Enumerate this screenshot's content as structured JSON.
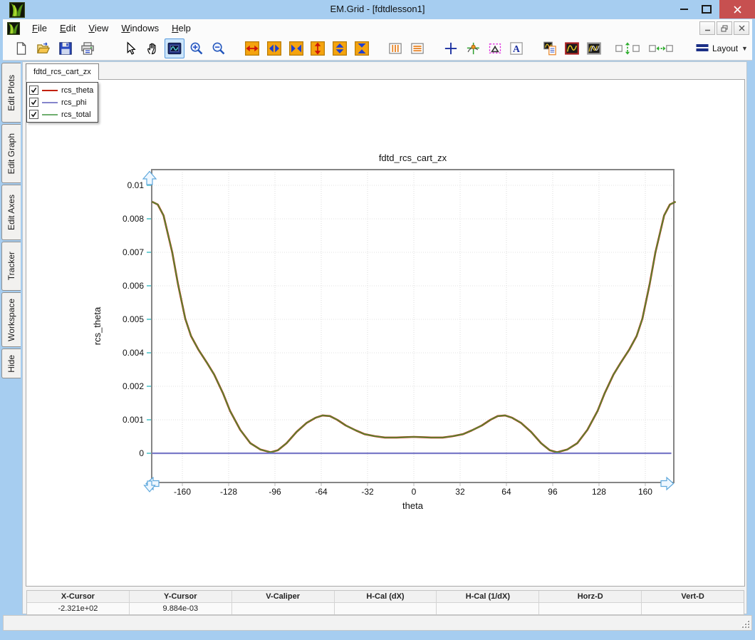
{
  "window": {
    "title": "EM.Grid - [fdtdlesson1]",
    "controls": [
      {
        "name": "minimize-button",
        "glyph": "minimize"
      },
      {
        "name": "maximize-button",
        "glyph": "maximize"
      },
      {
        "name": "close-button",
        "glyph": "close"
      }
    ]
  },
  "menu": {
    "items": [
      {
        "name": "menu-file",
        "label": "File"
      },
      {
        "name": "menu-edit",
        "label": "Edit"
      },
      {
        "name": "menu-view",
        "label": "View"
      },
      {
        "name": "menu-windows",
        "label": "Windows"
      },
      {
        "name": "menu-help",
        "label": "Help"
      }
    ],
    "mdi_controls": [
      {
        "name": "mdi-minimize-button",
        "glyph": "minimize"
      },
      {
        "name": "mdi-restore-button",
        "glyph": "restore"
      },
      {
        "name": "mdi-close-button",
        "glyph": "close"
      }
    ]
  },
  "toolbar": {
    "buttons": [
      {
        "name": "new-file-button",
        "icon": "new-file-icon"
      },
      {
        "name": "open-file-button",
        "icon": "open-folder-icon"
      },
      {
        "name": "save-button",
        "icon": "save-icon"
      },
      {
        "name": "print-button",
        "icon": "print-icon"
      },
      {
        "name": "select-cursor-button",
        "icon": "cursor-icon",
        "gap": "big"
      },
      {
        "name": "pan-button",
        "icon": "pan-hand-icon"
      },
      {
        "name": "zoom-box-button",
        "icon": "zoom-box-icon",
        "active": true
      },
      {
        "name": "zoom-in-button",
        "icon": "zoom-in-icon"
      },
      {
        "name": "zoom-out-button",
        "icon": "zoom-out-icon"
      },
      {
        "name": "h-full-scale-button",
        "icon": "h-expand-icon",
        "gap": "small"
      },
      {
        "name": "h-zoom-in-axis-button",
        "icon": "h-arrows-out-icon"
      },
      {
        "name": "h-zoom-out-axis-button",
        "icon": "h-arrows-in-icon"
      },
      {
        "name": "v-full-scale-button",
        "icon": "v-expand-icon"
      },
      {
        "name": "v-zoom-in-axis-button",
        "icon": "v-arrows-out-icon"
      },
      {
        "name": "v-zoom-out-axis-button",
        "icon": "v-arrows-in-icon"
      },
      {
        "name": "vertical-gridlines-button",
        "icon": "vertical-lines-icon",
        "gap": "small"
      },
      {
        "name": "horizontal-gridlines-button",
        "icon": "horizontal-lines-icon"
      },
      {
        "name": "crosshair-button",
        "icon": "crosshair-icon",
        "gap": "small"
      },
      {
        "name": "tracker-button",
        "icon": "tracker-icon"
      },
      {
        "name": "caliper-button",
        "icon": "caliper-icon"
      },
      {
        "name": "text-annotation-button",
        "icon": "text-a-icon"
      },
      {
        "name": "legend-button",
        "icon": "legend-icon",
        "gap": "small"
      },
      {
        "name": "single-trace-button",
        "icon": "single-wave-icon"
      },
      {
        "name": "multi-trace-button",
        "icon": "double-wave-icon"
      },
      {
        "name": "vertical-separation-button",
        "icon": "v-separation-icon",
        "gap": "small"
      },
      {
        "name": "horizontal-separation-button",
        "icon": "h-separation-icon",
        "gap": "small"
      }
    ],
    "layout_button": {
      "label": "Layout",
      "icon": "layout-icon"
    }
  },
  "sidebar": {
    "tabs": [
      {
        "name": "sidebar-tab-edit-plots",
        "label": "Edit Plots"
      },
      {
        "name": "sidebar-tab-edit-graph",
        "label": "Edit Graph"
      },
      {
        "name": "sidebar-tab-edit-axes",
        "label": "Edit Axes"
      },
      {
        "name": "sidebar-tab-tracker",
        "label": "Tracker"
      },
      {
        "name": "sidebar-tab-workspace",
        "label": "Workspace"
      },
      {
        "name": "sidebar-tab-hide",
        "label": "Hide"
      }
    ]
  },
  "document": {
    "tab_label": "fdtd_rcs_cart_zx"
  },
  "legend": {
    "entries": [
      {
        "label": "rcs_theta",
        "color": "#c22000",
        "checked": true
      },
      {
        "label": "rcs_phi",
        "color": "#8585cc",
        "checked": true
      },
      {
        "label": "rcs_total",
        "color": "#6fae6f",
        "checked": true
      }
    ]
  },
  "chart_data": {
    "type": "line",
    "title": "fdtd_rcs_cart_zx",
    "xlabel": "theta",
    "ylabel": "rcs_theta",
    "xlim": [
      -183,
      181
    ],
    "x_ticks": [
      -160,
      -128,
      -96,
      -64,
      -32,
      0,
      32,
      64,
      96,
      128,
      160
    ],
    "y_tick_labels": [
      "0",
      "0.001",
      "0.002",
      "0.004",
      "0.005",
      "0.006",
      "0.007",
      "0.008",
      "0.01"
    ],
    "y_tick_values": [
      0,
      0.001,
      0.002,
      0.004,
      0.005,
      0.006,
      0.007,
      0.008,
      0.01
    ],
    "grid": true,
    "legend_position": "top-left-floating",
    "series": [
      {
        "name": "rcs_theta",
        "color": "#b02800",
        "points": [
          [
            -181,
            0.00902
          ],
          [
            -177,
            0.00885
          ],
          [
            -173,
            0.0082
          ],
          [
            -167,
            0.007
          ],
          [
            -163,
            0.00605
          ],
          [
            -158,
            0.00502
          ],
          [
            -154,
            0.0045
          ],
          [
            -149,
            0.0041
          ],
          [
            -143,
            0.0034
          ],
          [
            -138,
            0.0027
          ],
          [
            -132,
            0.0018
          ],
          [
            -127,
            0.00126
          ],
          [
            -120,
            0.0007
          ],
          [
            -113,
            0.0003
          ],
          [
            -106,
            0.00011
          ],
          [
            -99,
            3e-05
          ],
          [
            -94,
            9e-05
          ],
          [
            -88,
            0.0003
          ],
          [
            -81,
            0.00064
          ],
          [
            -74,
            0.00091
          ],
          [
            -68,
            0.00106
          ],
          [
            -63,
            0.00113
          ],
          [
            -58,
            0.00111
          ],
          [
            -53,
            0.001
          ],
          [
            -47,
            0.00083
          ],
          [
            -40,
            0.00068
          ],
          [
            -34,
            0.00057
          ],
          [
            -27,
            0.00051
          ],
          [
            -20,
            0.00047
          ],
          [
            -12,
            0.00047
          ],
          [
            -6,
            0.00048
          ],
          [
            0,
            0.00049
          ],
          [
            6,
            0.00048
          ],
          [
            12,
            0.00047
          ],
          [
            20,
            0.00047
          ],
          [
            27,
            0.00051
          ],
          [
            34,
            0.00057
          ],
          [
            40,
            0.00068
          ],
          [
            47,
            0.00083
          ],
          [
            53,
            0.001
          ],
          [
            58,
            0.00111
          ],
          [
            63,
            0.00113
          ],
          [
            68,
            0.00106
          ],
          [
            74,
            0.00091
          ],
          [
            81,
            0.00064
          ],
          [
            88,
            0.0003
          ],
          [
            94,
            9e-05
          ],
          [
            99,
            3e-05
          ],
          [
            106,
            0.00011
          ],
          [
            113,
            0.0003
          ],
          [
            120,
            0.0007
          ],
          [
            127,
            0.00126
          ],
          [
            132,
            0.0018
          ],
          [
            138,
            0.0027
          ],
          [
            143,
            0.0034
          ],
          [
            149,
            0.0041
          ],
          [
            154,
            0.0045
          ],
          [
            158,
            0.00502
          ],
          [
            163,
            0.00605
          ],
          [
            167,
            0.007
          ],
          [
            173,
            0.0082
          ],
          [
            177,
            0.00885
          ],
          [
            181,
            0.00902
          ]
        ]
      },
      {
        "name": "rcs_phi",
        "color": "#7a7ac8",
        "points": [
          [
            -181,
            0
          ],
          [
            178,
            0
          ]
        ]
      },
      {
        "name": "rcs_total",
        "color": "#3f9e3f",
        "same_as": "rcs_theta"
      }
    ]
  },
  "status_table": {
    "columns": [
      "X-Cursor",
      "Y-Cursor",
      "V-Caliper",
      "H-Cal (dX)",
      "H-Cal (1/dX)",
      "Horz-D",
      "Vert-D"
    ],
    "values": [
      "-2.321e+02",
      "9.884e-03",
      "",
      "",
      "",
      "",
      ""
    ]
  }
}
